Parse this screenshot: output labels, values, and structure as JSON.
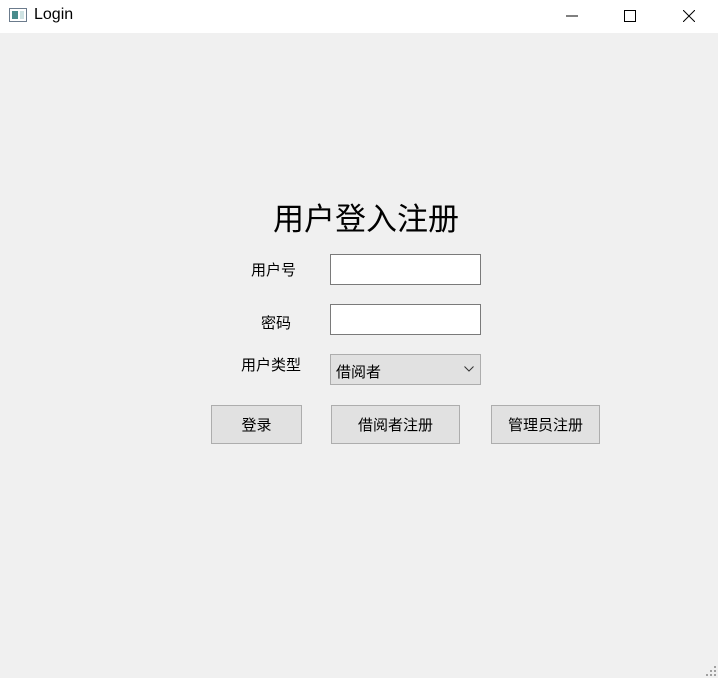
{
  "window": {
    "title": "Login",
    "icon": "app-window-icon",
    "controls": [
      "minimize-icon",
      "maximize-icon",
      "close-icon"
    ]
  },
  "form": {
    "heading": "用户登入注册",
    "username_label": "用户号",
    "username_value": "",
    "password_label": "密码",
    "password_value": "",
    "user_type_label": "用户类型",
    "user_type_selected": "借阅者"
  },
  "actions": {
    "login_label": "登录",
    "reader_register_label": "借阅者注册",
    "admin_register_label": "管理员注册"
  }
}
